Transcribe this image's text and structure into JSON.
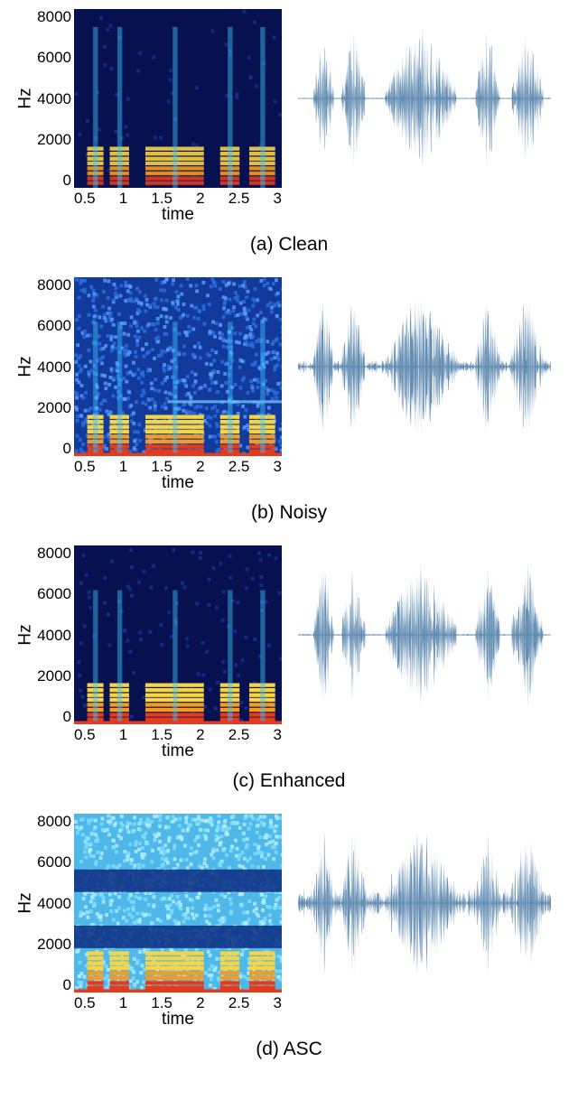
{
  "panels": [
    {
      "caption": "(a) Clean",
      "xlabel": "time",
      "ylabel": "Hz",
      "xticks": [
        "0.5",
        "1",
        "1.5",
        "2",
        "2.5",
        "3"
      ],
      "yticks": [
        "8000",
        "6000",
        "4000",
        "2000",
        "0"
      ],
      "spec_style": "clean",
      "wave_amp": 0.35
    },
    {
      "caption": "(b) Noisy",
      "xlabel": "time",
      "ylabel": "Hz",
      "xticks": [
        "0.5",
        "1",
        "1.5",
        "2",
        "2.5",
        "3"
      ],
      "yticks": [
        "8000",
        "6000",
        "4000",
        "2000",
        "0"
      ],
      "spec_style": "noisy",
      "wave_amp": 0.55
    },
    {
      "caption": "(c) Enhanced",
      "xlabel": "time",
      "ylabel": "Hz",
      "xticks": [
        "0.5",
        "1",
        "1.5",
        "2",
        "2.5",
        "3"
      ],
      "yticks": [
        "8000",
        "6000",
        "4000",
        "2000",
        "0"
      ],
      "spec_style": "enhanced",
      "wave_amp": 0.4
    },
    {
      "caption": "(d) ASC",
      "xlabel": "time",
      "ylabel": "Hz",
      "xticks": [
        "0.5",
        "1",
        "1.5",
        "2",
        "2.5",
        "3"
      ],
      "yticks": [
        "8000",
        "6000",
        "4000",
        "2000",
        "0"
      ],
      "spec_style": "asc",
      "wave_amp": 0.7
    }
  ],
  "chart_data": [
    {
      "type": "heatmap",
      "title": "(a) Clean — spectrogram",
      "xlabel": "time",
      "ylabel": "Hz",
      "xlim": [
        0,
        3.2
      ],
      "ylim": [
        0,
        8000
      ],
      "xticks": [
        0.5,
        1,
        1.5,
        2,
        2.5,
        3
      ],
      "yticks": [
        0,
        2000,
        4000,
        6000,
        8000
      ],
      "description": "Dark blue background with harmonic stacks (bright cyan/yellow bands) below ~2000 Hz during speech segments; sparse energy above 4000 Hz.",
      "speech_segments": [
        [
          0.2,
          0.45
        ],
        [
          0.55,
          0.85
        ],
        [
          1.1,
          2.0
        ],
        [
          2.25,
          2.55
        ],
        [
          2.7,
          3.1
        ]
      ]
    },
    {
      "type": "line",
      "title": "(a) Clean — waveform",
      "xlim": [
        0,
        3.2
      ],
      "ylim": [
        -1,
        1
      ],
      "description": "Near-zero baseline with bursts aligned to speech_segments; peak |amplitude| ≈ 0.8 near t=0.6–0.7."
    },
    {
      "type": "heatmap",
      "title": "(b) Noisy — spectrogram",
      "xlabel": "time",
      "ylabel": "Hz",
      "xlim": [
        0,
        3.2
      ],
      "ylim": [
        0,
        8000
      ],
      "xticks": [
        0.5,
        1,
        1.5,
        2,
        2.5,
        3
      ],
      "yticks": [
        0,
        2000,
        4000,
        6000,
        8000
      ],
      "description": "Broadband noise fills the whole plane (lighter blue speckle everywhere); speech harmonics still visible below 2000 Hz as brighter red/yellow; a faint horizontal tonal line around 2500 Hz from t≈1.5 to 3.0."
    },
    {
      "type": "line",
      "title": "(b) Noisy — waveform",
      "xlim": [
        0,
        3.2
      ],
      "ylim": [
        -1,
        1
      ],
      "description": "Speech bursts superimposed on continuous noise floor ≈ ±0.15 across full duration."
    },
    {
      "type": "heatmap",
      "title": "(c) Enhanced — spectrogram",
      "xlabel": "time",
      "ylabel": "Hz",
      "xlim": [
        0,
        3.2
      ],
      "ylim": [
        0,
        8000
      ],
      "xticks": [
        0.5,
        1,
        1.5,
        2,
        2.5,
        3
      ],
      "yticks": [
        0,
        2000,
        4000,
        6000,
        8000
      ],
      "description": "Background mostly dark again (noise reduced); low-frequency harmonics below 2000 Hz and some vertical energy up to ~6000 Hz around t=0.3, 1.2–1.6, 2.3, 2.9; residual red line along 0 Hz."
    },
    {
      "type": "line",
      "title": "(c) Enhanced — waveform",
      "xlim": [
        0,
        3.2
      ],
      "ylim": [
        -1,
        1
      ],
      "description": "Similar to Clean: near-zero baseline with bursts; peak near t≈0.6."
    },
    {
      "type": "heatmap",
      "title": "(d) ASC — spectrogram",
      "xlabel": "time",
      "ylabel": "Hz",
      "xlim": [
        0,
        3.2
      ],
      "ylim": [
        0,
        8000
      ],
      "xticks": [
        0.5,
        1,
        1.5,
        2,
        2.5,
        3
      ],
      "yticks": [
        0,
        2000,
        4000,
        6000,
        8000
      ],
      "description": "Very bright overall (light cyan). Two dark horizontal bands roughly 2000–3000 Hz and 4500–5500 Hz across all time; speech harmonics in orange/red below 2000 Hz."
    },
    {
      "type": "line",
      "title": "(d) ASC — waveform",
      "xlim": [
        0,
        3.2
      ],
      "ylim": [
        -1,
        1
      ],
      "description": "Strong broadband noise floor ≈ ±0.35 across full duration with speech bursts on top."
    }
  ],
  "colors": {
    "waveform": "#4a7ba6",
    "spec_dark": "#08114f",
    "spec_mid": "#1a4fb8",
    "spec_light": "#3fc6ff",
    "spec_hot": "#f7d442",
    "spec_red": "#e23b1e"
  }
}
